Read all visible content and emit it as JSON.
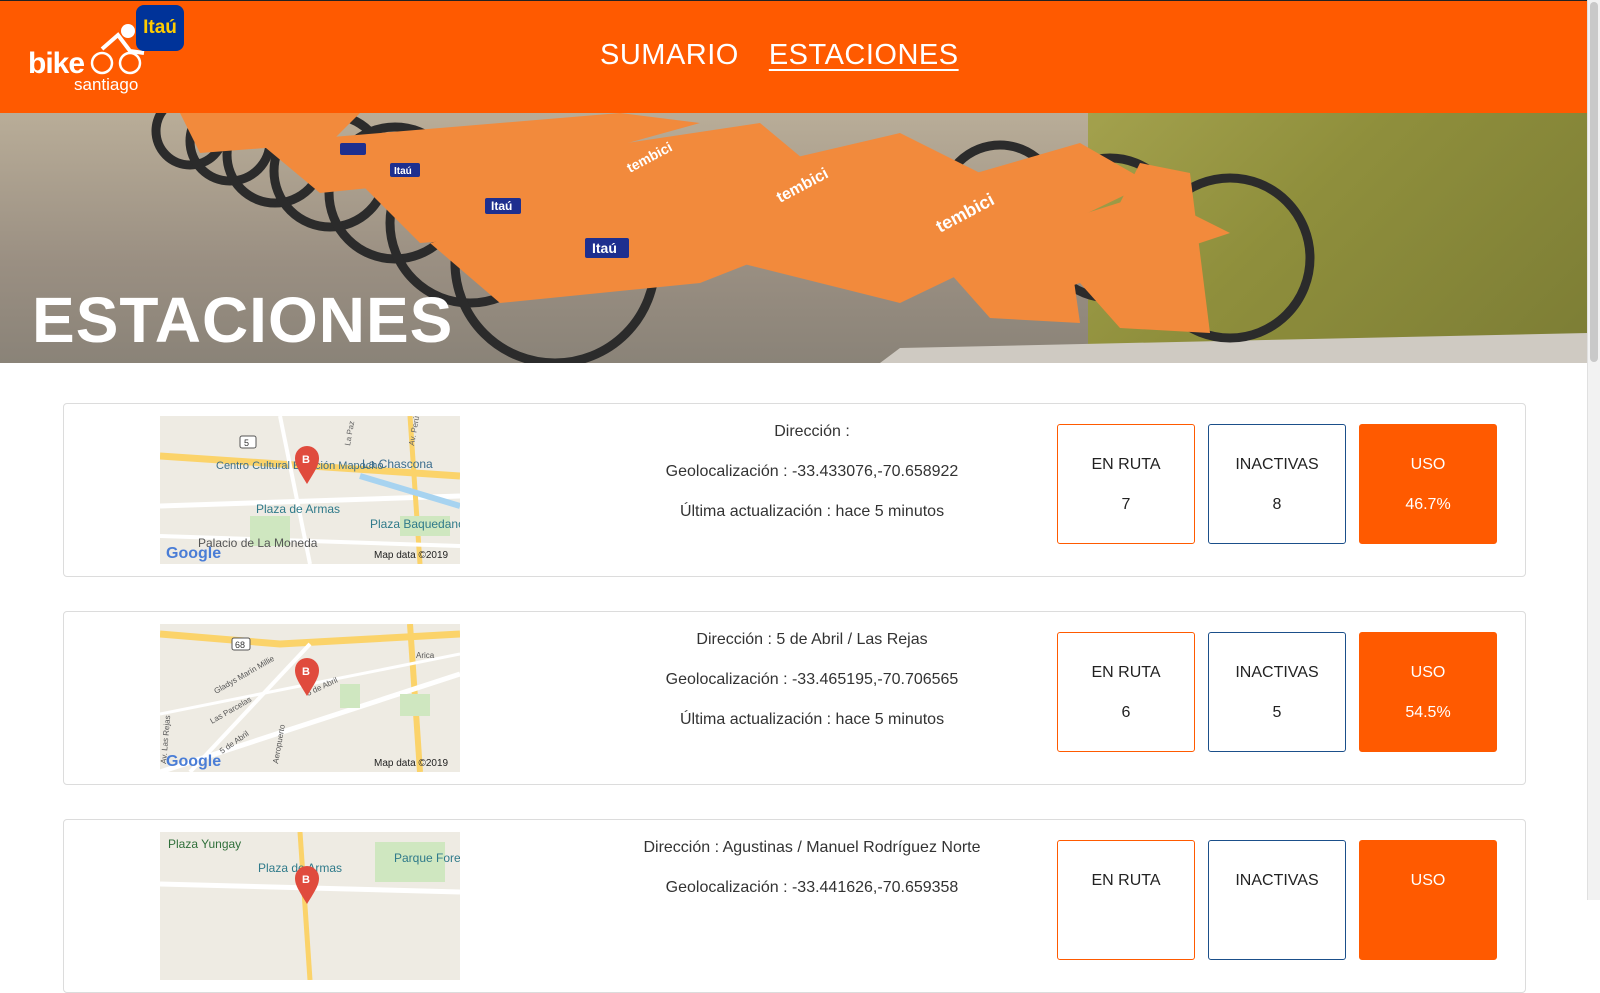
{
  "header": {
    "logo_bike": "bike",
    "logo_city": "santiago",
    "logo_sponsor": "Itaú",
    "nav": [
      {
        "label": "SUMARIO",
        "active": false
      },
      {
        "label": "ESTACIONES",
        "active": true
      }
    ]
  },
  "hero": {
    "title": "ESTACIONES",
    "bike_brand": "tembici",
    "sponsor": "Itaú"
  },
  "stations": [
    {
      "direccion": "Dirección :",
      "geolocalizacion": "Geolocalización : -33.433076,-70.658922",
      "actualizacion": "Última actualización : hace 5 minutos",
      "en_ruta_label": "EN RUTA",
      "en_ruta": "7",
      "inactivas_label": "INACTIVAS",
      "inactivas": "8",
      "uso_label": "USO",
      "uso": "46.7%",
      "map": {
        "labels": [
          "La Chascona",
          "Centro Cultural Estación Mapocho",
          "Plaza de Armas",
          "Plaza Baquedano",
          "Palacio de La Moneda",
          "La Paz",
          "Av. Perú"
        ],
        "road_shield": "5",
        "marker": "B",
        "google": "Google",
        "credit": "Map data ©2019"
      }
    },
    {
      "direccion": "Dirección : 5 de Abril / Las Rejas",
      "geolocalizacion": "Geolocalización : -33.465195,-70.706565",
      "actualizacion": "Última actualización : hace 5 minutos",
      "en_ruta_label": "EN RUTA",
      "en_ruta": "6",
      "inactivas_label": "INACTIVAS",
      "inactivas": "5",
      "uso_label": "USO",
      "uso": "54.5%",
      "map": {
        "labels": [
          "Arica",
          "Gladys Marín Millie",
          "5 de Abril",
          "Las Parcelas",
          "5 de Abril",
          "Aeropuerto",
          "Av. Las Rejas"
        ],
        "road_shield": "68",
        "marker": "B",
        "google": "Google",
        "credit": "Map data ©2019"
      }
    },
    {
      "direccion": "Dirección : Agustinas / Manuel Rodríguez Norte",
      "geolocalizacion": "Geolocalización : -33.441626,-70.659358",
      "actualizacion": "",
      "en_ruta_label": "EN RUTA",
      "en_ruta": "",
      "inactivas_label": "INACTIVAS",
      "inactivas": "",
      "uso_label": "USO",
      "uso": "",
      "map": {
        "labels": [
          "Plaza Yungay",
          "Plaza de Armas",
          "Parque Forestal"
        ],
        "road_shield": "",
        "marker": "B",
        "google": "",
        "credit": ""
      }
    }
  ],
  "colors": {
    "brand_orange": "#ff5a00",
    "inactive_border": "#1b4f8a",
    "itau_blue": "#003399",
    "itau_yellow": "#ffcc00"
  }
}
